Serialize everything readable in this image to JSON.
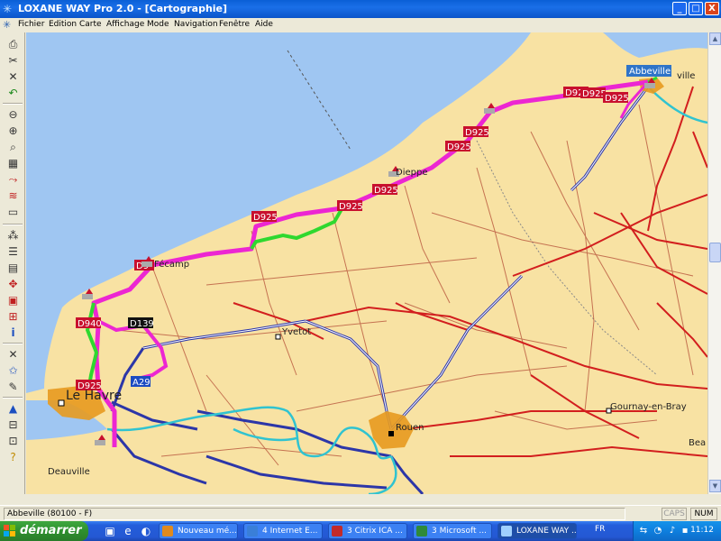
{
  "window": {
    "title": "LOXANE WAY Pro 2.0 - [Cartographie]",
    "min_symbol": "_",
    "max_symbol": "□",
    "close_symbol": "X"
  },
  "menu": {
    "items": [
      "Fichier",
      "Edition",
      "Carte",
      "Affichage",
      "Mode",
      "Navigation",
      "Fenêtre",
      "Aide"
    ],
    "mdi_min": "_",
    "mdi_max": "□",
    "mdi_close": "x"
  },
  "toolbar": {
    "icons": [
      "print-icon",
      "cut-icon",
      "delete-icon",
      "undo-icon",
      "zoom-out-icon",
      "zoom-in-icon",
      "zoom-area-icon",
      "select-icon",
      "route-icon",
      "layers-icon",
      "measure-icon",
      "legend-icon",
      "list-icon",
      "tile-icon",
      "grid-icon",
      "window-icon",
      "info-icon",
      "tools-icon",
      "star-icon",
      "pointer-icon",
      "road-icon",
      "layout-icon",
      "settings-icon",
      "help-icon"
    ]
  },
  "map": {
    "colors": {
      "land": "#f8e2a3",
      "sea": "#9fc6f2",
      "route": "#ec26d2",
      "alt_route": "#2fd82f",
      "highway": "#2c36a8",
      "main_road": "#d21e1e",
      "minor_road": "#b44d36",
      "river": "#30c3d0",
      "city_area": "#e79a1f"
    },
    "cities": [
      {
        "name": "Abbeville",
        "highlight": true
      },
      {
        "name": "ville"
      },
      {
        "name": "Dieppe"
      },
      {
        "name": "Fécamp"
      },
      {
        "name": "Yvetot"
      },
      {
        "name": "Le Havre",
        "big": true
      },
      {
        "name": "Rouen"
      },
      {
        "name": "Gournay-en-Bray"
      },
      {
        "name": "Bea"
      },
      {
        "name": "Deauville"
      }
    ],
    "road_labels": [
      "D925",
      "D925",
      "D925",
      "D925",
      "D925",
      "D925",
      "D925",
      "D925",
      "D940",
      "D139",
      "A29",
      "D925",
      "D9"
    ]
  },
  "status": {
    "location": "Abbeville (80100 - F)",
    "caps": "CAPS",
    "num": "NUM"
  },
  "taskbar": {
    "start_label": "démarrer",
    "tasks": [
      {
        "label": "Nouveau mé...",
        "color": "#e08a1e"
      },
      {
        "label": "4 Internet E...",
        "color": "#3a7fd8"
      },
      {
        "label": "3 Citrix ICA ...",
        "color": "#c22a2a"
      },
      {
        "label": "3 Microsoft ...",
        "color": "#2f8a3a"
      },
      {
        "label": "LOXANE WAY ...",
        "color": "#1e4ea8",
        "active": true
      }
    ],
    "lang": "FR",
    "clock": "11:12"
  }
}
